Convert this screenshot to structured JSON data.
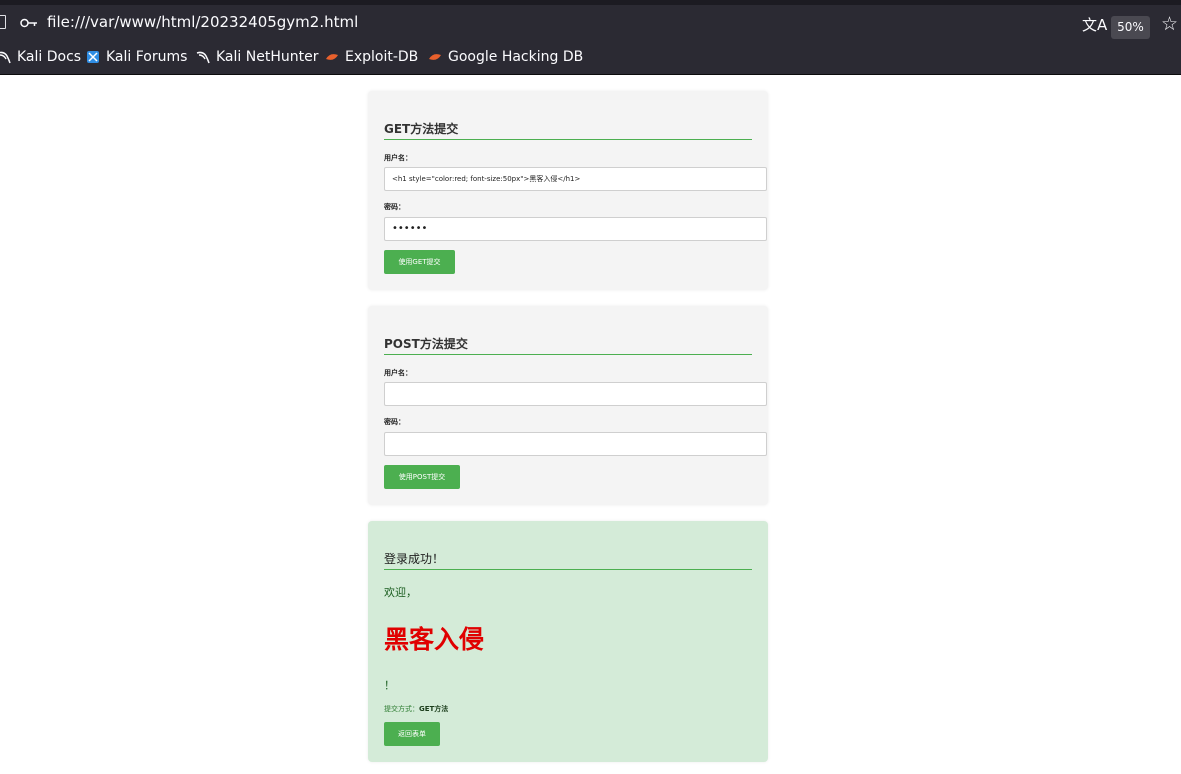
{
  "browser": {
    "url": "file:///var/www/html/20232405gym2.html",
    "zoom": "50%",
    "bookmarks": [
      "Kali Docs",
      "Kali Forums",
      "Kali NetHunter",
      "Exploit-DB",
      "Google Hacking DB"
    ]
  },
  "get_form": {
    "title": "GET方法提交",
    "username_label": "用户名：",
    "username_value": "<h1 style=\"color:red; font-size:50px\">黑客入侵</h1>",
    "password_label": "密码：",
    "password_value": "••••••",
    "submit_label": "使用GET提交"
  },
  "post_form": {
    "title": "POST方法提交",
    "username_label": "用户名：",
    "username_value": "",
    "password_label": "密码：",
    "password_value": "",
    "submit_label": "使用POST提交"
  },
  "result": {
    "title": "登录成功！",
    "welcome": "欢迎，",
    "injected_heading": "黑客入侵",
    "exclamation": "！",
    "method_prefix": "提交方式：",
    "method_value": "GET方法",
    "back_label": "返回表单"
  },
  "colors": {
    "accent_green": "#4caf50",
    "result_bg": "#d4ebd8",
    "injected_red": "#e00000"
  }
}
